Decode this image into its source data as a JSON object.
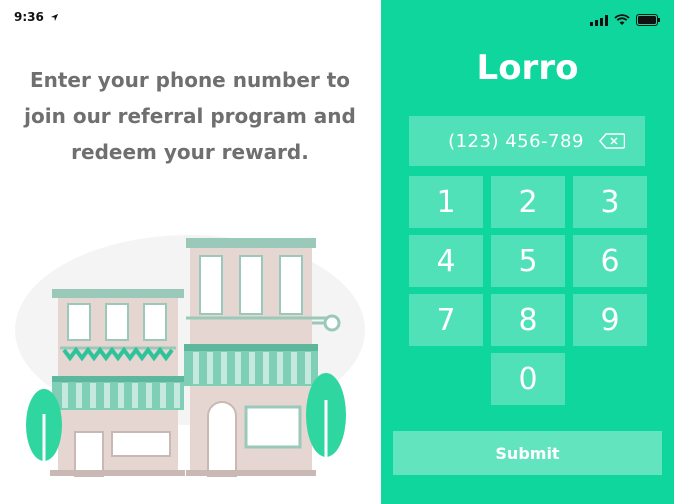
{
  "status_bar": {
    "time": "9:36",
    "location_icon": "location-arrow-icon",
    "signal_icon": "cellular-signal-icon",
    "wifi_icon": "wifi-icon",
    "battery_icon": "battery-icon"
  },
  "left_panel": {
    "heading": "Enter your phone number to join our referral program and redeem your reward.",
    "illustration": "storefronts-illustration"
  },
  "right_panel": {
    "app_title": "Lorro",
    "phone_value": "(123) 456-789",
    "backspace_icon": "backspace-icon",
    "keys": [
      "1",
      "2",
      "3",
      "4",
      "5",
      "6",
      "7",
      "8",
      "9",
      "0"
    ],
    "submit_label": "Submit"
  },
  "colors": {
    "accent": "#0fd69d",
    "heading_text": "#6f6f6f",
    "illustration_pink": "#e6d6d2",
    "illustration_teal": "#7fcfb6"
  }
}
